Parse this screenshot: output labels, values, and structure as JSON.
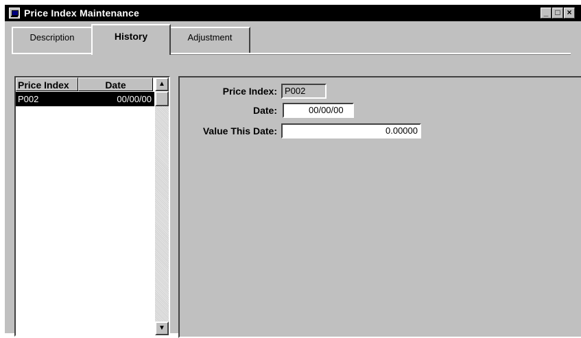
{
  "window": {
    "title": "Price Index Maintenance",
    "buttons": {
      "minimize": "_",
      "maximize": "□",
      "close": "×"
    }
  },
  "tabs": [
    {
      "label": "Description",
      "active": false
    },
    {
      "label": "History",
      "active": true
    },
    {
      "label": "Adjustment",
      "active": false
    }
  ],
  "list": {
    "headers": [
      "Price Index",
      "Date"
    ],
    "rows": [
      {
        "price_index": "P002",
        "date": "00/00/00",
        "selected": true
      }
    ],
    "scroll_up": "▲",
    "scroll_down": "▼"
  },
  "form": {
    "price_index_label": "Price Index:",
    "price_index_value": "P002",
    "date_label": "Date:",
    "date_value": "00/00/00",
    "value_label": "Value This Date:",
    "value_value": "0.00000"
  },
  "colors": {
    "face": "#c0c0c0",
    "title_bar": "#000000",
    "selection": "#000000"
  }
}
